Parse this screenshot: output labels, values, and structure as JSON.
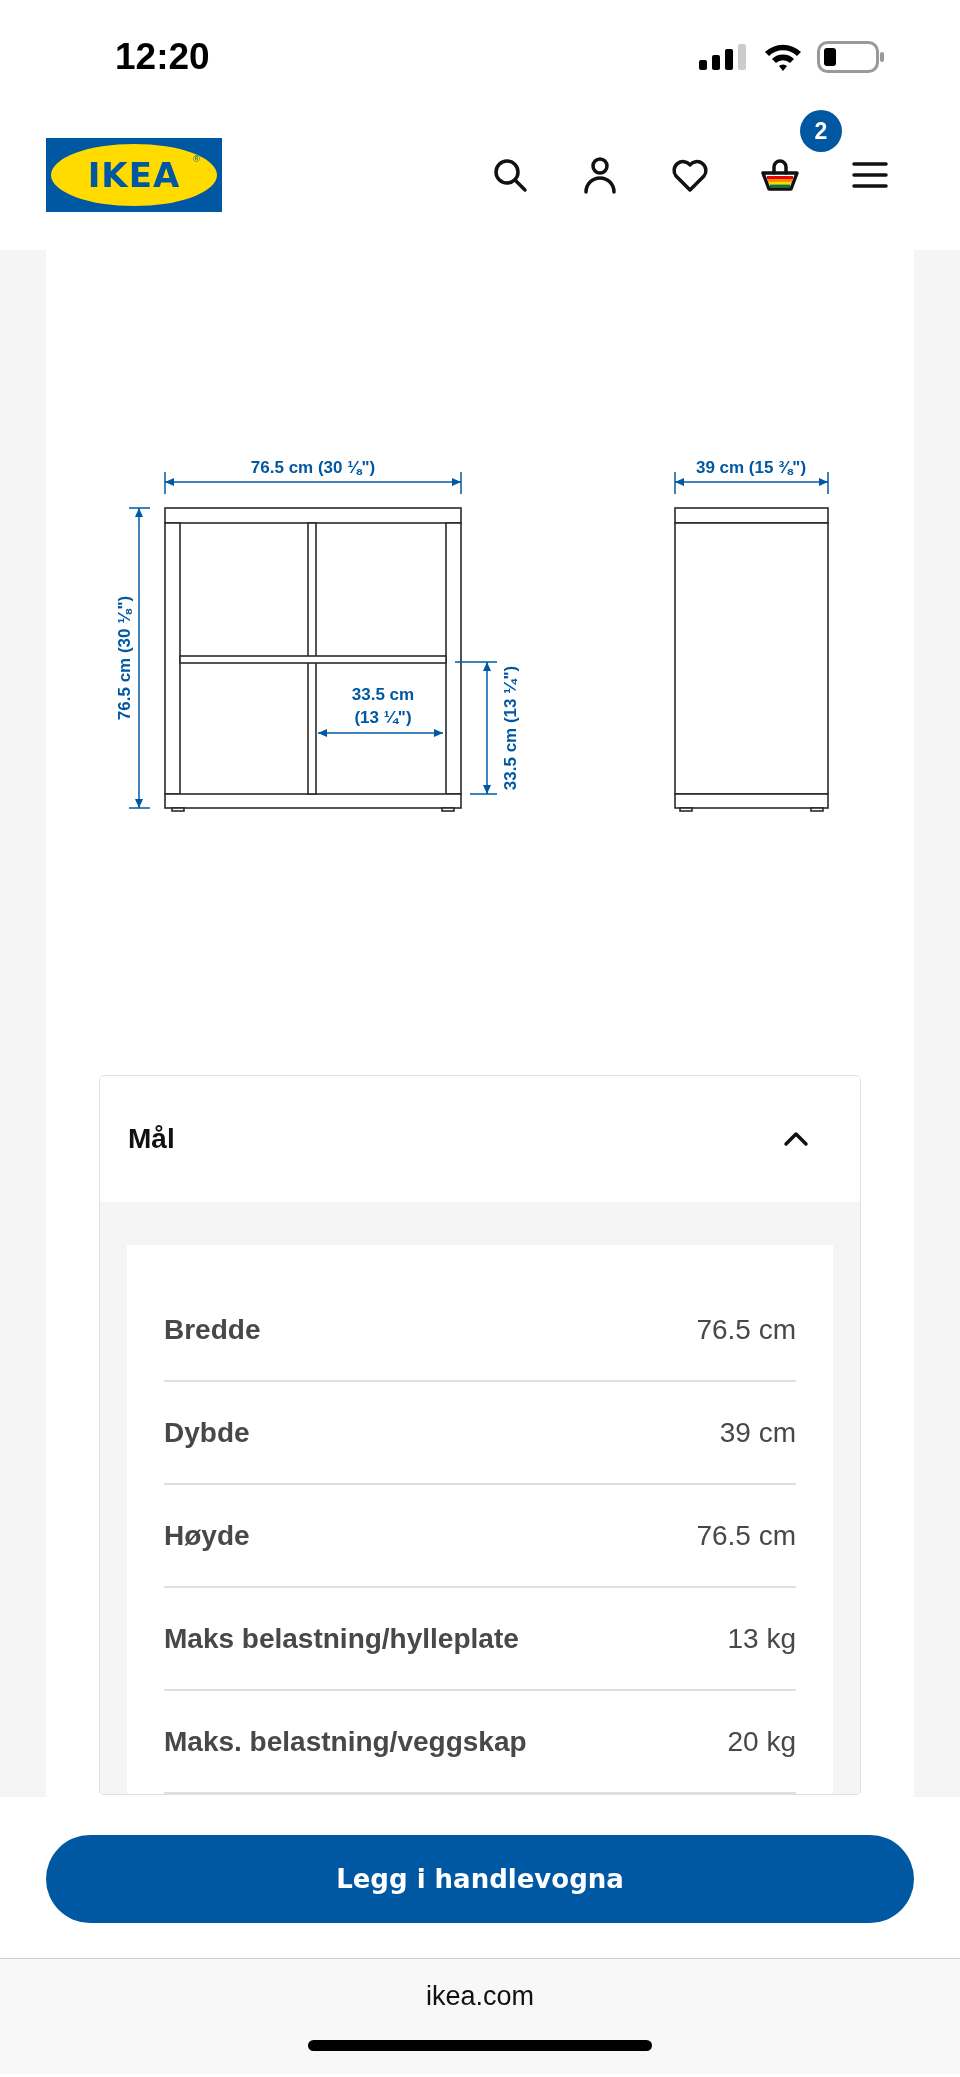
{
  "status_bar": {
    "time": "12:20"
  },
  "header": {
    "logo": {
      "text": "IKEA",
      "mark": "®"
    },
    "cart_count": "2"
  },
  "diagram": {
    "width_label": "76.5 cm (30 ⅛\")",
    "height_label": "76.5 cm (30 ⅛\")",
    "inner_width_label": [
      "33.5 cm",
      "(13 ¼\")"
    ],
    "inner_height_label": "33.5 cm (13 ¼\")",
    "depth_label": "39 cm (15 ⅜\")"
  },
  "dimensions": {
    "title": "Mål",
    "expanded": true,
    "rows": [
      {
        "label": "Bredde",
        "value": "76.5 cm"
      },
      {
        "label": "Dybde",
        "value": "39 cm"
      },
      {
        "label": "Høyde",
        "value": "76.5 cm"
      },
      {
        "label": "Maks belastning/hylleplate",
        "value": "13 kg"
      },
      {
        "label": "Maks. belastning/veggskap",
        "value": "20 kg"
      }
    ]
  },
  "add_button": "Legg i handlevogna",
  "browser": {
    "url": "ikea.com"
  }
}
